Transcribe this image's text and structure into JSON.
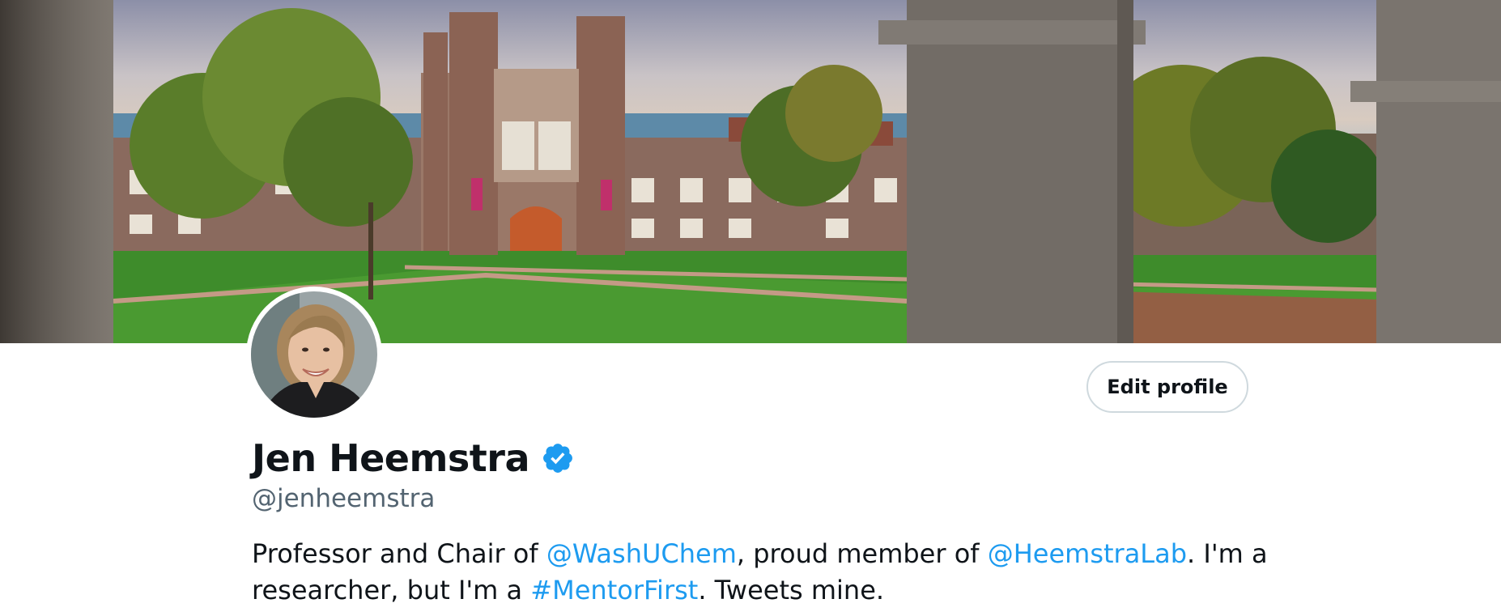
{
  "banner": {
    "description_icon": "campus-photo"
  },
  "avatar": {
    "icon": "profile-photo"
  },
  "actions": {
    "edit_profile_label": "Edit profile"
  },
  "profile": {
    "display_name": "Jen Heemstra",
    "verified_icon": "verified-badge-icon",
    "handle": "@jenheemstra",
    "bio": {
      "part1": "Professor and Chair of ",
      "mention1": "@WashUChem",
      "part2": ", proud member of ",
      "mention2": "@HeemstraLab",
      "part3": ". I'm a researcher, but I'm a ",
      "hashtag": "#MentorFirst",
      "part4": ". Tweets mine."
    }
  },
  "colors": {
    "link": "#1d9bf0",
    "secondary_text": "#536471",
    "verified": "#1d9bf0"
  }
}
